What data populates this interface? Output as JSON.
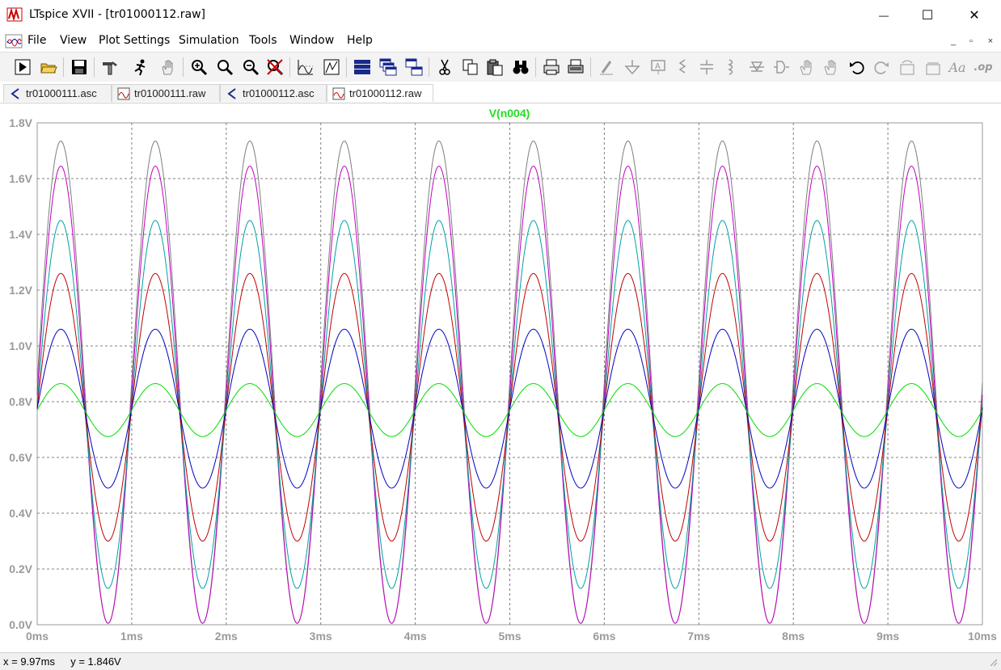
{
  "window": {
    "title": "LTspice XVII - [tr01000112.raw]",
    "minimize_glyph": "—",
    "maximize_glyph": "☐",
    "close_glyph": "✕"
  },
  "menu": {
    "items": [
      "File",
      "View",
      "Plot Settings",
      "Simulation",
      "Tools",
      "Window",
      "Help"
    ]
  },
  "mdi": {
    "minimize": "_",
    "restore": "▫",
    "close": "×"
  },
  "toolbar": {
    "buttons": [
      "run-icon",
      "open-icon",
      "save-icon",
      "control-panel-icon",
      "run-halt-icon",
      "pan-icon",
      "zoom-in-icon",
      "zoom-area-icon",
      "zoom-out-icon",
      "zoom-cancel-icon",
      "autorange-icon",
      "fft-icon",
      "tile-horizontal-icon",
      "cascade-icon",
      "tile-vertical-icon",
      "cut-icon",
      "copy-icon",
      "paste-icon",
      "find-icon",
      "print-preview-icon",
      "print-icon",
      "wire-icon",
      "ground-icon",
      "label-icon",
      "resistor-icon",
      "capacitor-icon",
      "inductor-icon",
      "diode-icon",
      "component-icon",
      "move-icon",
      "drag-icon",
      "undo-icon",
      "redo-icon",
      "rotate-icon",
      "mirror-icon",
      "text-icon",
      "spice-directive-icon"
    ],
    "text_icon_label": "Aa",
    "op_icon_label": ".op"
  },
  "tabs": [
    {
      "label": "tr01000111.asc",
      "kind": "schematic-icon"
    },
    {
      "label": "tr01000111.raw",
      "kind": "waveform-icon"
    },
    {
      "label": "tr01000112.asc",
      "kind": "schematic-icon"
    },
    {
      "label": "tr01000112.raw",
      "kind": "waveform-icon",
      "active": true
    }
  ],
  "status": {
    "cursor_x": "x = 9.97ms",
    "cursor_y": "y = 1.846V"
  },
  "colors": {
    "grid": "#808080",
    "axis_label": "#9a9a9a",
    "title": "#22dd22",
    "series": [
      "#7f7f7f",
      "#c000c0",
      "#00a0a0",
      "#c00000",
      "#0000c0",
      "#00dd00"
    ]
  },
  "chart_data": {
    "type": "line",
    "title": "V(n004)",
    "xlabel": "",
    "ylabel": "",
    "xlim": [
      0,
      10
    ],
    "ylim": [
      0,
      1.8
    ],
    "grid": true,
    "x_ticks": [
      "0ms",
      "1ms",
      "2ms",
      "3ms",
      "4ms",
      "5ms",
      "6ms",
      "7ms",
      "8ms",
      "9ms",
      "10ms"
    ],
    "y_ticks": [
      "0.0V",
      "0.2V",
      "0.4V",
      "0.6V",
      "0.8V",
      "1.0V",
      "1.2V",
      "1.4V",
      "1.6V",
      "1.8V"
    ],
    "frequency_khz": 1,
    "series": [
      {
        "color": "#7f7f7f",
        "offset_v": 0.87,
        "amplitude_v": 0.865,
        "peak_v": 1.735,
        "trough_v": 0.005
      },
      {
        "color": "#c000c0",
        "offset_v": 0.825,
        "amplitude_v": 0.82,
        "peak_v": 1.645,
        "trough_v": 0.005
      },
      {
        "color": "#00a0a0",
        "offset_v": 0.79,
        "amplitude_v": 0.66,
        "peak_v": 1.45,
        "trough_v": 0.13
      },
      {
        "color": "#c00000",
        "offset_v": 0.78,
        "amplitude_v": 0.48,
        "peak_v": 1.26,
        "trough_v": 0.3
      },
      {
        "color": "#0000c0",
        "offset_v": 0.775,
        "amplitude_v": 0.285,
        "peak_v": 1.06,
        "trough_v": 0.49
      },
      {
        "color": "#00dd00",
        "offset_v": 0.77,
        "amplitude_v": 0.095,
        "peak_v": 0.865,
        "trough_v": 0.675
      }
    ]
  }
}
